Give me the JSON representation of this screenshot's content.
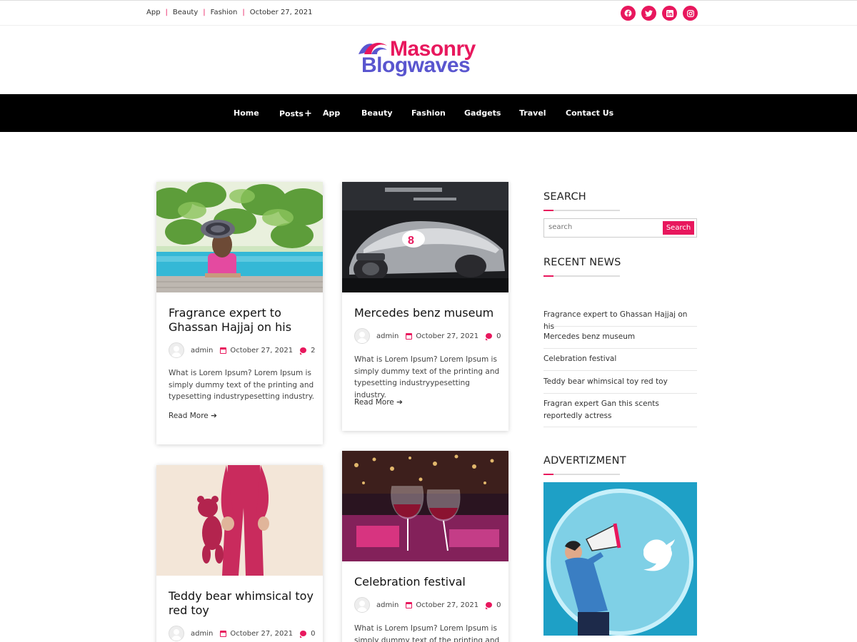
{
  "topbar": {
    "links": [
      "App",
      "Beauty",
      "Fashion"
    ],
    "date": "October 27, 2021",
    "social_icons": [
      "facebook-icon",
      "twitter-icon",
      "linkedin-icon",
      "instagram-icon"
    ],
    "accent": "#e8175d"
  },
  "logo": {
    "line1": "Masonry",
    "line2": "Blogwaves",
    "color1": "#e8175d",
    "color2": "#5a56cf"
  },
  "nav": {
    "items": [
      "Home",
      "Posts",
      "App",
      "Beauty",
      "Fashion",
      "Gadgets",
      "Travel",
      "Contact Us"
    ],
    "posts_icon": "+"
  },
  "posts": [
    {
      "title": "Fragrance expert to Ghassan Hajjaj on his",
      "author": "admin",
      "date": "October 27, 2021",
      "comments": "2",
      "excerpt": "What is Lorem Ipsum? Lorem Ipsum is simply dummy text of the printing and typesetting industrypesetting industry.",
      "read_more": "Read More"
    },
    {
      "title": "Mercedes benz museum",
      "author": "admin",
      "date": "October 27, 2021",
      "comments": "0",
      "excerpt": "What is Lorem Ipsum? Lorem Ipsum is simply dummy text of the printing and typesetting industryypesetting industry.",
      "read_more": "Read More"
    },
    {
      "title": "Teddy bear whimsical toy red toy",
      "author": "admin",
      "date": "October 27, 2021",
      "comments": "0"
    },
    {
      "title": "Celebration festival",
      "author": "admin",
      "date": "October 27, 2021",
      "comments": "0",
      "excerpt": "What is Lorem Ipsum? Lorem Ipsum is simply dummy text of the printing and"
    }
  ],
  "sidebar": {
    "search_title": "SEARCH",
    "search_placeholder": "search",
    "search_button": "Search",
    "recent_title": "RECENT NEWS",
    "recent": [
      "Fragrance expert to Ghassan Hajjaj on his",
      "Mercedes benz museum",
      "Celebration festival",
      "Teddy bear whimsical toy red toy",
      "Fragran expert Gan this scents reportedly actress"
    ],
    "ad_title": "ADVERTIZMENT"
  }
}
